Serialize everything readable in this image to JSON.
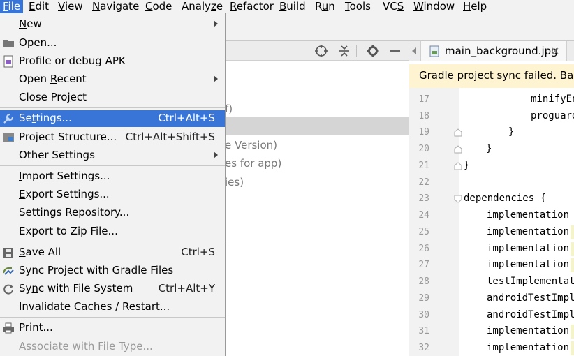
{
  "menubar": {
    "items": [
      {
        "pre": "",
        "mn": "F",
        "post": "ile"
      },
      {
        "pre": "",
        "mn": "E",
        "post": "dit"
      },
      {
        "pre": "",
        "mn": "V",
        "post": "iew"
      },
      {
        "pre": "",
        "mn": "N",
        "post": "avigate"
      },
      {
        "pre": "",
        "mn": "C",
        "post": "ode"
      },
      {
        "pre": "Analy",
        "mn": "z",
        "post": "e"
      },
      {
        "pre": "",
        "mn": "R",
        "post": "efactor"
      },
      {
        "pre": "",
        "mn": "B",
        "post": "uild"
      },
      {
        "pre": "R",
        "mn": "u",
        "post": "n"
      },
      {
        "pre": "",
        "mn": "T",
        "post": "ools"
      },
      {
        "pre": "VC",
        "mn": "S",
        "post": ""
      },
      {
        "pre": "",
        "mn": "W",
        "post": "indow"
      },
      {
        "pre": "",
        "mn": "H",
        "post": "elp"
      }
    ]
  },
  "file_menu": {
    "items": [
      {
        "pre": "",
        "mn": "N",
        "post": "ew",
        "shortcut": "",
        "submenu": true
      },
      {
        "pre": "",
        "mn": "O",
        "post": "pen...",
        "shortcut": "",
        "submenu": false
      },
      {
        "pre": "Profile or debug APK",
        "mn": "",
        "post": "",
        "shortcut": "",
        "submenu": false
      },
      {
        "pre": "Open ",
        "mn": "R",
        "post": "ecent",
        "shortcut": "",
        "submenu": true
      },
      {
        "pre": "Close Pro",
        "mn": "j",
        "post": "ect",
        "shortcut": "",
        "submenu": false
      },
      {
        "pre": "Se",
        "mn": "t",
        "post": "tings...",
        "shortcut": "Ctrl+Alt+S",
        "submenu": false
      },
      {
        "pre": "Project Structure...",
        "mn": "",
        "post": "",
        "shortcut": "Ctrl+Alt+Shift+S",
        "submenu": false
      },
      {
        "pre": "Other Settings",
        "mn": "",
        "post": "",
        "shortcut": "",
        "submenu": true
      },
      {
        "pre": "",
        "mn": "I",
        "post": "mport Settings...",
        "shortcut": "",
        "submenu": false
      },
      {
        "pre": "",
        "mn": "E",
        "post": "xport Settings...",
        "shortcut": "",
        "submenu": false
      },
      {
        "pre": "Settings Repository...",
        "mn": "",
        "post": "",
        "shortcut": "",
        "submenu": false
      },
      {
        "pre": "Export to Zip File...",
        "mn": "",
        "post": "",
        "shortcut": "",
        "submenu": false
      },
      {
        "pre": "",
        "mn": "S",
        "post": "ave All",
        "shortcut": "Ctrl+S",
        "submenu": false
      },
      {
        "pre": "Sync Project with Gradle Files",
        "mn": "",
        "post": "",
        "shortcut": "",
        "submenu": false
      },
      {
        "pre": "Sy",
        "mn": "n",
        "post": "c with File System",
        "shortcut": "Ctrl+Alt+Y",
        "submenu": false
      },
      {
        "pre": "Invalidate Caches / Restart...",
        "mn": "",
        "post": "",
        "shortcut": "",
        "submenu": false
      },
      {
        "pre": "",
        "mn": "P",
        "post": "rint...",
        "shortcut": "",
        "submenu": false
      },
      {
        "pre": "Associate with File Type...",
        "mn": "",
        "post": "",
        "shortcut": "",
        "submenu": false
      }
    ]
  },
  "project_panel": {
    "tree_fragments": [
      "f)",
      "e Version)",
      "es for app)",
      "ies)"
    ]
  },
  "editor": {
    "tab_label": "main_background.jpg",
    "banner_text": "Gradle project sync failed. Basic",
    "lines": [
      {
        "num": "17",
        "text": "minifyEn"
      },
      {
        "num": "18",
        "text": "proguard"
      },
      {
        "num": "19",
        "text": "}"
      },
      {
        "num": "20",
        "text": "}"
      },
      {
        "num": "21",
        "text": "}"
      },
      {
        "num": "22",
        "text": ""
      },
      {
        "num": "23",
        "text": "dependencies {"
      },
      {
        "num": "24",
        "text": "implementation f"
      },
      {
        "num": "25",
        "text": "implementation '"
      },
      {
        "num": "26",
        "text": "implementation '"
      },
      {
        "num": "27",
        "text": "implementation '"
      },
      {
        "num": "28",
        "text": "testImplementati"
      },
      {
        "num": "29",
        "text": "androidTestImple"
      },
      {
        "num": "30",
        "text": "androidTestImple"
      },
      {
        "num": "31",
        "text": "implementation '"
      },
      {
        "num": "32",
        "text": "implementation '"
      }
    ]
  },
  "colors": {
    "selection": "#3875d7",
    "menu_bg": "#f2f2f2",
    "banner_bg": "#fff4d2"
  }
}
